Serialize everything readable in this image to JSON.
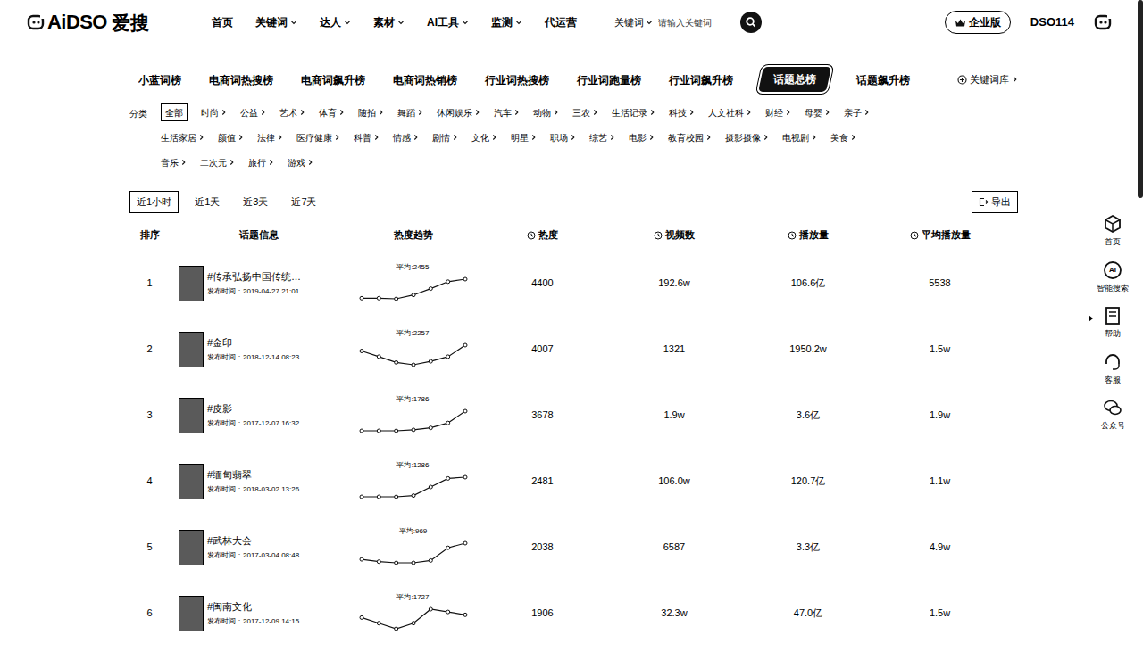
{
  "header": {
    "logo": {
      "text": "AiDSO",
      "cn": "爱搜"
    },
    "nav": [
      {
        "label": "首页",
        "dropdown": false
      },
      {
        "label": "关键词",
        "dropdown": true
      },
      {
        "label": "达人",
        "dropdown": true
      },
      {
        "label": "素材",
        "dropdown": true
      },
      {
        "label": "AI工具",
        "dropdown": true
      },
      {
        "label": "监测",
        "dropdown": true
      },
      {
        "label": "代运营",
        "dropdown": false
      }
    ],
    "search": {
      "scope": "关键词",
      "placeholder": "请输入关键词"
    },
    "enterprise": "企业版",
    "user": "DSO114"
  },
  "board_tabs": [
    {
      "label": "小蓝词榜",
      "selected": false
    },
    {
      "label": "电商词热搜榜",
      "selected": false
    },
    {
      "label": "电商词飙升榜",
      "selected": false
    },
    {
      "label": "电商词热销榜",
      "selected": false
    },
    {
      "label": "行业词热搜榜",
      "selected": false
    },
    {
      "label": "行业词跑量榜",
      "selected": false
    },
    {
      "label": "行业词飙升榜",
      "selected": false
    },
    {
      "label": "话题总榜",
      "selected": true
    },
    {
      "label": "话题飙升榜",
      "selected": false
    }
  ],
  "keyword_library": "关键词库",
  "category_label": "分类",
  "category_rows": [
    [
      {
        "label": "全部",
        "selected": true,
        "submenu": false
      },
      {
        "label": "时尚",
        "selected": false,
        "submenu": true
      },
      {
        "label": "公益",
        "selected": false,
        "submenu": true
      },
      {
        "label": "艺术",
        "selected": false,
        "submenu": true
      },
      {
        "label": "体育",
        "selected": false,
        "submenu": true
      },
      {
        "label": "随拍",
        "selected": false,
        "submenu": true
      },
      {
        "label": "舞蹈",
        "selected": false,
        "submenu": true
      },
      {
        "label": "休闲娱乐",
        "selected": false,
        "submenu": true
      },
      {
        "label": "汽车",
        "selected": false,
        "submenu": true
      },
      {
        "label": "动物",
        "selected": false,
        "submenu": true
      },
      {
        "label": "三农",
        "selected": false,
        "submenu": true
      },
      {
        "label": "生活记录",
        "selected": false,
        "submenu": true
      },
      {
        "label": "科技",
        "selected": false,
        "submenu": true
      },
      {
        "label": "人文社科",
        "selected": false,
        "submenu": true
      },
      {
        "label": "财经",
        "selected": false,
        "submenu": true
      },
      {
        "label": "母婴",
        "selected": false,
        "submenu": true
      },
      {
        "label": "亲子",
        "selected": false,
        "submenu": true
      }
    ],
    [
      {
        "label": "生活家居",
        "selected": false,
        "submenu": true
      },
      {
        "label": "颜值",
        "selected": false,
        "submenu": true
      },
      {
        "label": "法律",
        "selected": false,
        "submenu": true
      },
      {
        "label": "医疗健康",
        "selected": false,
        "submenu": true
      },
      {
        "label": "科普",
        "selected": false,
        "submenu": true
      },
      {
        "label": "情感",
        "selected": false,
        "submenu": true
      },
      {
        "label": "剧情",
        "selected": false,
        "submenu": true
      },
      {
        "label": "文化",
        "selected": false,
        "submenu": true
      },
      {
        "label": "明星",
        "selected": false,
        "submenu": true
      },
      {
        "label": "职场",
        "selected": false,
        "submenu": true
      },
      {
        "label": "综艺",
        "selected": false,
        "submenu": true
      },
      {
        "label": "电影",
        "selected": false,
        "submenu": true
      },
      {
        "label": "教育校园",
        "selected": false,
        "submenu": true
      },
      {
        "label": "摄影摄像",
        "selected": false,
        "submenu": true
      },
      {
        "label": "电视剧",
        "selected": false,
        "submenu": true
      },
      {
        "label": "美食",
        "selected": false,
        "submenu": true
      }
    ],
    [
      {
        "label": "音乐",
        "selected": false,
        "submenu": true
      },
      {
        "label": "二次元",
        "selected": false,
        "submenu": true
      },
      {
        "label": "旅行",
        "selected": false,
        "submenu": true
      },
      {
        "label": "游戏",
        "selected": false,
        "submenu": true
      }
    ]
  ],
  "time_ranges": [
    {
      "label": "近1小时",
      "selected": true
    },
    {
      "label": "近1天",
      "selected": false
    },
    {
      "label": "近3天",
      "selected": false
    },
    {
      "label": "近7天",
      "selected": false
    }
  ],
  "export": "导出",
  "table": {
    "columns": [
      {
        "label": "排序",
        "info": false
      },
      {
        "label": "话题信息",
        "info": false
      },
      {
        "label": "热度趋势",
        "info": false
      },
      {
        "label": "热度",
        "info": true
      },
      {
        "label": "视频数",
        "info": true
      },
      {
        "label": "播放量",
        "info": true
      },
      {
        "label": "平均播放量",
        "info": true
      }
    ],
    "rows": [
      {
        "rank": "1",
        "title": "#传承弘扬中国传统…",
        "published": "发布时间：2019-04-27 21:01",
        "trend_avg": "平均:2455",
        "trend": [
          2300,
          2300,
          2290,
          2350,
          2450,
          2560,
          2600
        ],
        "heat": "4400",
        "videos": "192.6w",
        "plays": "106.6亿",
        "avg_plays": "5538"
      },
      {
        "rank": "2",
        "title": "#金印",
        "published": "发布时间：2018-12-14 08:23",
        "trend_avg": "平均:2257",
        "trend": [
          2350,
          2300,
          2250,
          2230,
          2260,
          2300,
          2400
        ],
        "heat": "4007",
        "videos": "1321",
        "plays": "1950.2w",
        "avg_plays": "1.5w"
      },
      {
        "rank": "3",
        "title": "#皮影",
        "published": "发布时间：2017-12-07 16:32",
        "trend_avg": "平均:1786",
        "trend": [
          1700,
          1700,
          1700,
          1710,
          1730,
          1780,
          1900
        ],
        "heat": "3678",
        "videos": "1.9w",
        "plays": "3.6亿",
        "avg_plays": "1.9w"
      },
      {
        "rank": "4",
        "title": "#缅甸翡翠",
        "published": "发布时间：2018-03-02 13:26",
        "trend_avg": "平均:1286",
        "trend": [
          1200,
          1200,
          1200,
          1210,
          1280,
          1350,
          1360
        ],
        "heat": "2481",
        "videos": "106.0w",
        "plays": "120.7亿",
        "avg_plays": "1.1w"
      },
      {
        "rank": "5",
        "title": "#武林大会",
        "published": "发布时间：2017-03-04 08:48",
        "trend_avg": "平均:969",
        "trend": [
          900,
          880,
          870,
          870,
          890,
          1000,
          1040
        ],
        "heat": "2038",
        "videos": "6587",
        "plays": "3.3亿",
        "avg_plays": "4.9w"
      },
      {
        "rank": "6",
        "title": "#闽南文化",
        "published": "发布时间：2017-12-09 14:15",
        "trend_avg": "平均:1727",
        "trend": [
          1700,
          1660,
          1620,
          1660,
          1760,
          1740,
          1720
        ],
        "heat": "1906",
        "videos": "32.3w",
        "plays": "47.0亿",
        "avg_plays": "1.5w"
      }
    ]
  },
  "side_toolbar": [
    {
      "label": "首页",
      "icon": "cube",
      "icon_text": "",
      "pointer": false
    },
    {
      "label": "智能搜索",
      "icon": "ai",
      "icon_text": "AI",
      "pointer": false
    },
    {
      "label": "帮助",
      "icon": "book",
      "icon_text": "",
      "pointer": true
    },
    {
      "label": "客服",
      "icon": "headset",
      "icon_text": "",
      "pointer": false
    },
    {
      "label": "公众号",
      "icon": "wechat",
      "icon_text": "",
      "pointer": false
    }
  ]
}
